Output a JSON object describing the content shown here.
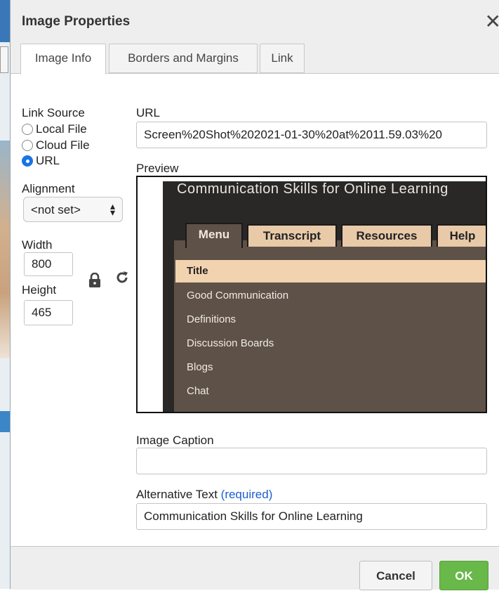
{
  "dialog": {
    "title": "Image Properties",
    "close_symbol": "✕"
  },
  "tabs": [
    {
      "label": "Image Info",
      "active": true
    },
    {
      "label": "Borders and Margins",
      "active": false
    },
    {
      "label": "Link",
      "active": false
    }
  ],
  "link_source": {
    "label": "Link Source",
    "options": [
      {
        "label": "Local File",
        "selected": false
      },
      {
        "label": "Cloud File",
        "selected": false
      },
      {
        "label": "URL",
        "selected": true
      }
    ]
  },
  "alignment": {
    "label": "Alignment",
    "value": "<not set>"
  },
  "dimensions": {
    "width_label": "Width",
    "width_value": "800",
    "height_label": "Height",
    "height_value": "465",
    "lock_icon": "lock-icon",
    "reset_icon": "reset-size-icon"
  },
  "url": {
    "label": "URL",
    "value": "Screen%20Shot%202021-01-30%20at%2011.59.03%20"
  },
  "preview": {
    "label": "Preview",
    "content_title": "Communication Skills for Online Learning",
    "tabs": [
      "Menu",
      "Transcript",
      "Resources",
      "Help"
    ],
    "menu_items": [
      "Title",
      "Good Communication",
      "Definitions",
      "Discussion Boards",
      "Blogs",
      "Chat"
    ]
  },
  "caption": {
    "label": "Image Caption",
    "value": ""
  },
  "alt_text": {
    "label": "Alternative Text",
    "required": "(required)",
    "value": "Communication Skills for Online Learning"
  },
  "buttons": {
    "cancel": "Cancel",
    "ok": "OK"
  },
  "colors": {
    "ok_green": "#68b84a",
    "radio_blue": "#1a73e8",
    "required_blue": "#1a5fd0"
  }
}
